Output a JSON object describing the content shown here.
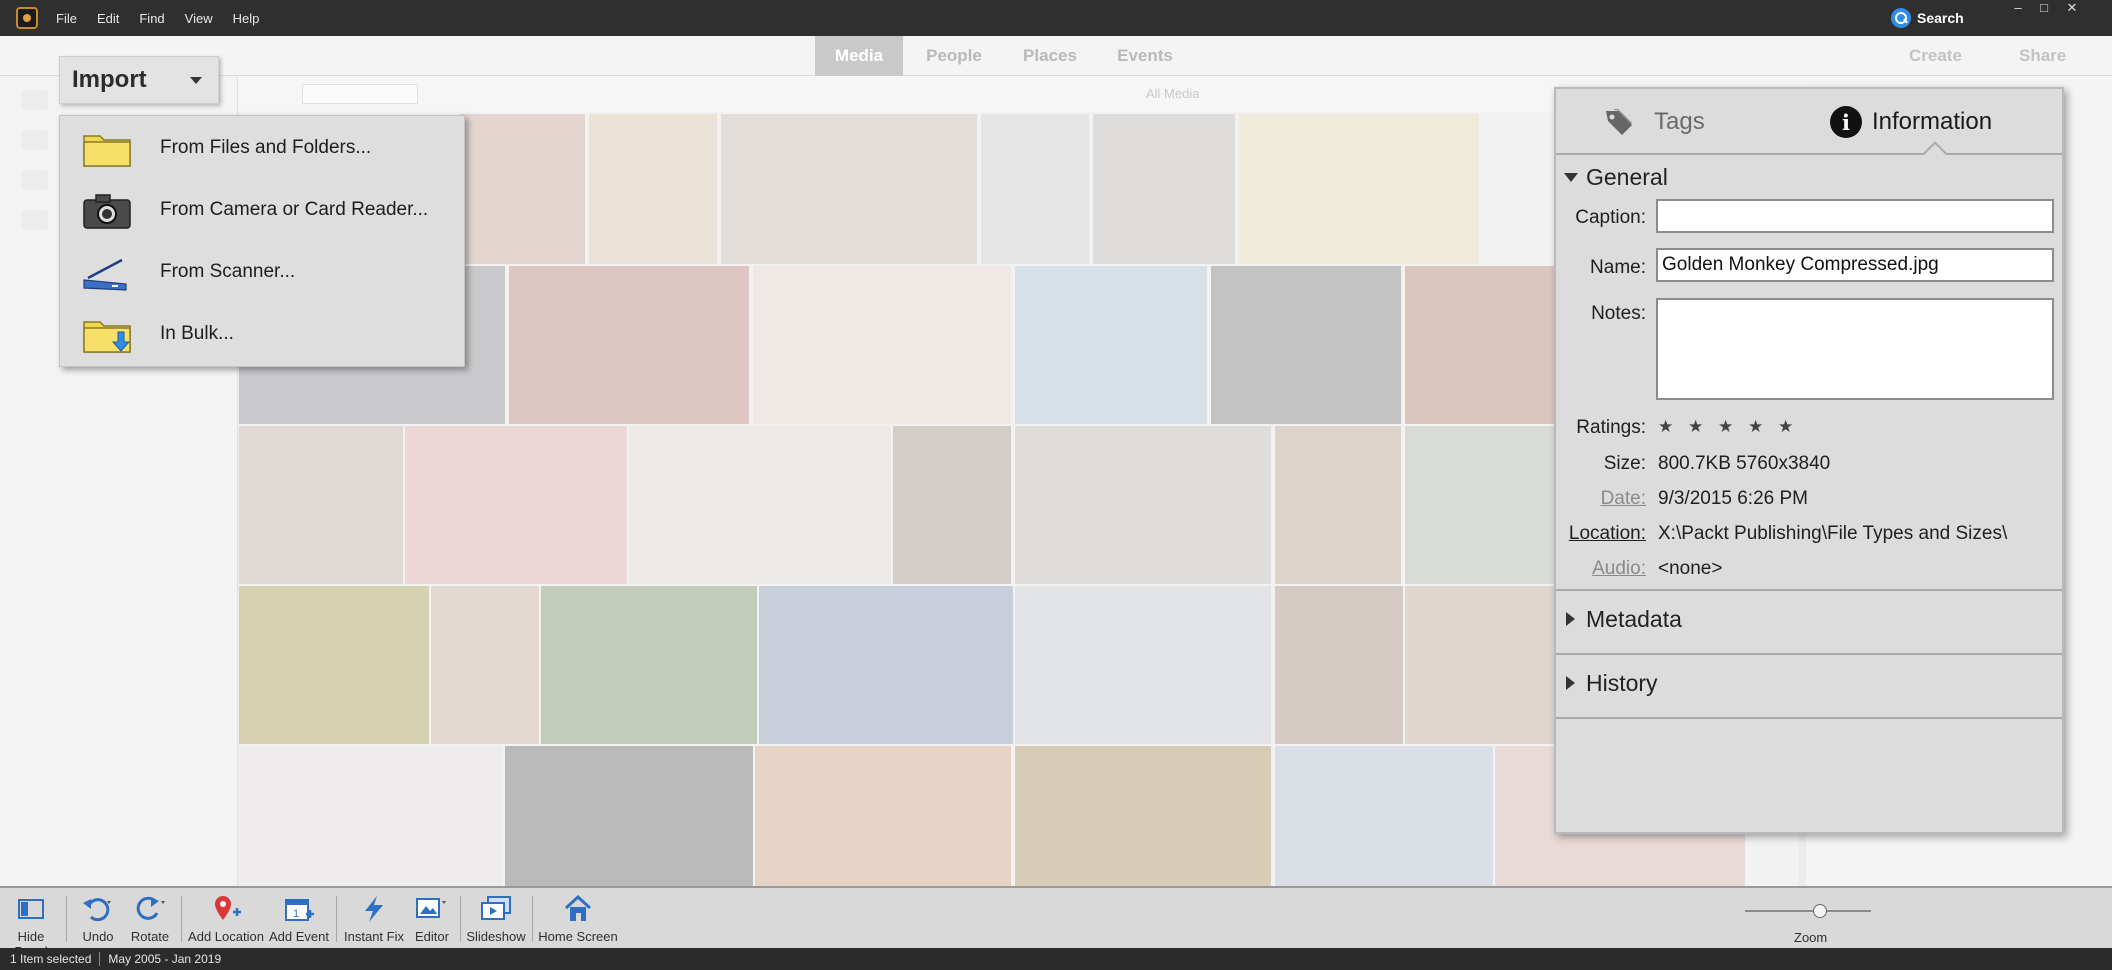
{
  "titlebar": {
    "menu": [
      "File",
      "Edit",
      "Find",
      "View",
      "Help"
    ],
    "search_label": "Search"
  },
  "topnav": {
    "tabs": [
      {
        "label": "Media",
        "active": true
      },
      {
        "label": "People",
        "active": false
      },
      {
        "label": "Places",
        "active": false
      },
      {
        "label": "Events",
        "active": false
      }
    ],
    "create_label": "Create",
    "share_label": "Share",
    "all_media_label": "All Media"
  },
  "import_menu": {
    "button_label": "Import",
    "items": [
      {
        "label": "From Files and Folders...",
        "icon": "folder-icon"
      },
      {
        "label": "From Camera or Card Reader...",
        "icon": "camera-icon"
      },
      {
        "label": "From Scanner...",
        "icon": "scanner-icon"
      },
      {
        "label": "In Bulk...",
        "icon": "bulk-import-folder-icon"
      }
    ]
  },
  "info_panel": {
    "tabs": {
      "tags": "Tags",
      "information": "Information"
    },
    "general": {
      "title": "General",
      "caption_label": "Caption:",
      "caption_value": "",
      "name_label": "Name:",
      "name_value": "Golden Monkey Compressed.jpg",
      "notes_label": "Notes:",
      "notes_value": "",
      "ratings_label": "Ratings:",
      "rating_value": 0,
      "rating_max": 5,
      "size_label": "Size:",
      "size_value": "800.7KB  5760x3840",
      "date_label": "Date:",
      "date_value": "9/3/2015 6:26 PM",
      "location_label": "Location:",
      "location_value": "X:\\Packt Publishing\\File Types and Sizes\\",
      "audio_label": "Audio:",
      "audio_value": "<none>"
    },
    "metadata_title": "Metadata",
    "history_title": "History"
  },
  "bottombar": {
    "tools": [
      "Hide Panel",
      "Undo",
      "Rotate",
      "Add Location",
      "Add Event",
      "Instant Fix",
      "Editor",
      "Slideshow",
      "Home Screen"
    ],
    "zoom_label": "Zoom"
  },
  "statusbar": {
    "selection": "1 Item selected",
    "date_range": "May 2005 - Jan 2019"
  },
  "colors": {
    "titlebar_bg": "#2f2f2f",
    "accent_blue": "#2e8de6",
    "panel_bg": "#dcdcdc",
    "folder_yellow": "#f2d64b"
  }
}
